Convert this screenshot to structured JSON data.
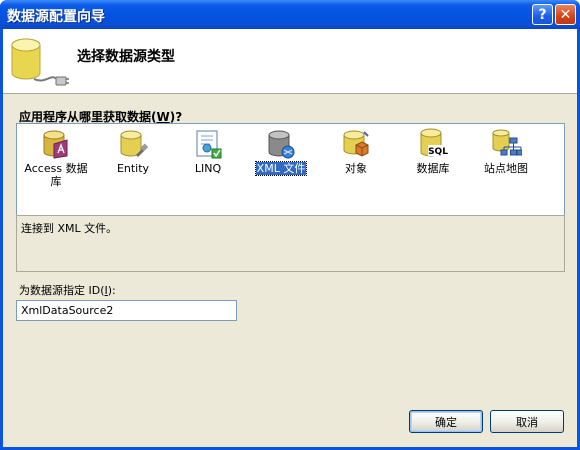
{
  "window": {
    "title": "数据源配置向导",
    "help_glyph": "?",
    "close_glyph": "✕"
  },
  "header": {
    "title": "选择数据源类型",
    "icon": "database-plug-icon"
  },
  "question": {
    "prefix": "应用程序从哪里获取数据(",
    "accel": "W",
    "suffix": ")?"
  },
  "types": [
    {
      "label": "Access 数据库",
      "icon": "access-database-icon",
      "selected": false
    },
    {
      "label": "Entity",
      "icon": "entity-icon",
      "selected": false
    },
    {
      "label": "LINQ",
      "icon": "linq-icon",
      "selected": false
    },
    {
      "label": "XML 文件",
      "icon": "xml-file-icon",
      "selected": true
    },
    {
      "label": "对象",
      "icon": "object-icon",
      "selected": false
    },
    {
      "label": "数据库",
      "icon": "sql-database-icon",
      "selected": false
    },
    {
      "label": "站点地图",
      "icon": "site-map-icon",
      "selected": false
    }
  ],
  "description": "连接到 XML 文件。",
  "id_field": {
    "label_prefix": "为数据源指定 ID(",
    "accel": "I",
    "label_suffix": "):",
    "value": "XmlDataSource2"
  },
  "buttons": {
    "ok": "确定",
    "cancel": "取消"
  },
  "colors": {
    "title_bar": "#0552e0",
    "selection": "#316ac5",
    "dialog_bg": "#ece9d8"
  }
}
